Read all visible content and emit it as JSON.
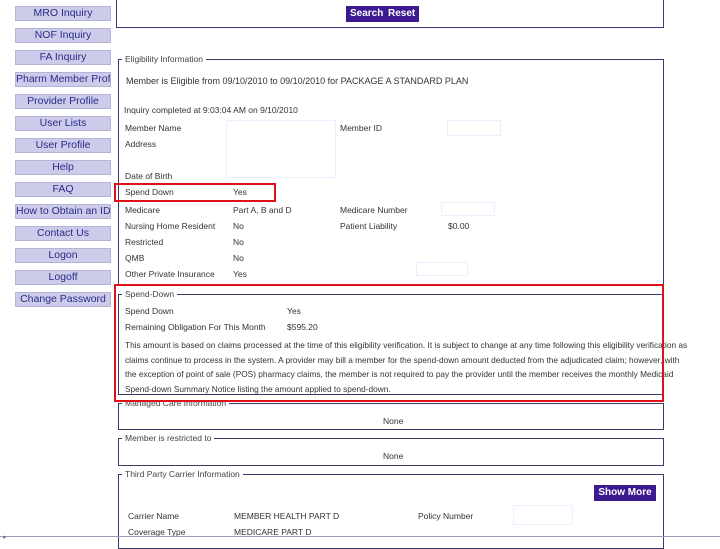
{
  "sidebar": {
    "items": [
      {
        "label": "MRO Inquiry"
      },
      {
        "label": "NOF Inquiry"
      },
      {
        "label": "FA Inquiry"
      },
      {
        "label": "Pharm Member Profile"
      },
      {
        "label": "Provider Profile"
      },
      {
        "label": "User Lists"
      },
      {
        "label": "User Profile"
      },
      {
        "label": "Help"
      },
      {
        "label": "FAQ"
      },
      {
        "label": "How to Obtain an ID"
      },
      {
        "label": "Contact Us"
      },
      {
        "label": "Logon"
      },
      {
        "label": "Logoff"
      },
      {
        "label": "Change Password"
      }
    ]
  },
  "toolbar": {
    "search_label": "Search",
    "reset_label": "Reset"
  },
  "eligibility": {
    "legend": "Eligibility Information",
    "eligible_message": "Member is Eligible from 09/10/2010 to 09/10/2010 for PACKAGE A STANDARD PLAN",
    "inquiry_completed": "Inquiry completed at 9:03:04 AM on 9/10/2010",
    "labels": {
      "member_name": "Member Name",
      "member_id": "Member ID",
      "address": "Address",
      "dob": "Date of Birth",
      "spend_down": "Spend Down",
      "medicare": "Medicare",
      "medicare_number": "Medicare Number",
      "nursing_home": "Nursing Home Resident",
      "patient_liability": "Patient Liability",
      "restricted": "Restricted",
      "qmb": "QMB",
      "other_insurance": "Other Private Insurance"
    },
    "values": {
      "spend_down": "Yes",
      "medicare": "Part A, B and D",
      "nursing_home": "No",
      "patient_liability": "$0.00",
      "restricted": "No",
      "qmb": "No",
      "other_insurance": "Yes"
    }
  },
  "spend_down_section": {
    "legend": "Spend-Down",
    "spend_down_label": "Spend Down",
    "spend_down_value": "Yes",
    "remaining_label": "Remaining Obligation For This Month",
    "remaining_value": "$595.20",
    "notice_lines": [
      "This amount is based on claims processed at the time of this eligibility verification. It is subject to change at any time following this eligibility verification as",
      "claims continue to process in the system. A provider may bill a member for the spend-down amount deducted from the adjudicated claim; however, with",
      "the exception of point of sale (POS) pharmacy claims, the member is not required to pay the provider until the member receives the monthly Medicaid",
      "Spend-down Summary Notice listing the amount applied to spend-down."
    ]
  },
  "managed_care": {
    "legend": "Managed Care Information",
    "value": "None"
  },
  "restricted_to": {
    "legend": "Member is restricted to",
    "value": "None"
  },
  "third_party": {
    "legend": "Third Party Carrier Information",
    "show_more_label": "Show More",
    "carrier_label": "Carrier Name",
    "carrier_value": "MEMBER HEALTH PART D",
    "policy_label": "Policy Number",
    "coverage_label": "Coverage Type",
    "coverage_value": "MEDICARE PART D"
  },
  "colors": {
    "nav_bg": "#ccccea",
    "nav_text": "#2a2a8a",
    "button_bg": "#3d1a8f",
    "highlight": "#e0101a"
  }
}
